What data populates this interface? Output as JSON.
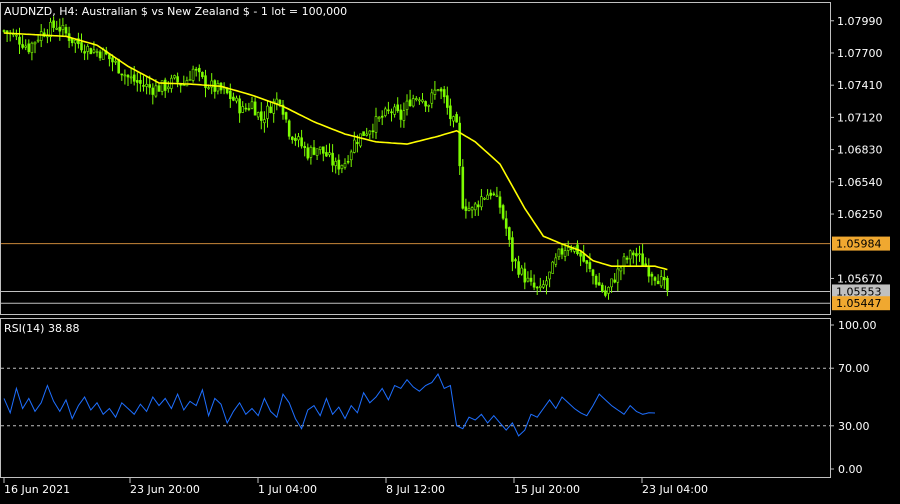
{
  "header": {
    "symbol_line": "AUDNZD, H4:  Australian $ vs New Zealand $ - 1 lot = 100,000"
  },
  "colors": {
    "background": "#000000",
    "frame": "#c0c0c0",
    "text": "#ffffff",
    "candle": "#7cfc00",
    "moving_average": "#ffff00",
    "rsi_line": "#1e6fff",
    "hline_upper": "#c8873a",
    "hline_lower": "#c0c0c0",
    "tag_upper": "#f0a830",
    "tag_current": "#c0c0c0",
    "tag_lower": "#f0a830"
  },
  "chart_data": [
    {
      "type": "candlestick",
      "symbol": "AUDNZD",
      "timeframe": "H4",
      "title": "AUDNZD, H4:  Australian $ vs New Zealand $ - 1 lot = 100,000",
      "y_range": [
        1.0535,
        1.0815
      ],
      "y_ticks": [
        "1.07990",
        "1.07700",
        "1.07410",
        "1.07120",
        "1.06830",
        "1.06540",
        "1.06250",
        "1.05670"
      ],
      "x_labels": [
        "16 Jun 2021",
        "23 Jun 20:00",
        "1 Jul 04:00",
        "8 Jul 12:00",
        "15 Jul 20:00",
        "23 Jul 04:00"
      ],
      "close_waypoints": [
        [
          0,
          1.079
        ],
        [
          4,
          1.0784
        ],
        [
          8,
          1.0775
        ],
        [
          12,
          1.0788
        ],
        [
          17,
          1.0795
        ],
        [
          22,
          1.0782
        ],
        [
          27,
          1.0774
        ],
        [
          32,
          1.077
        ],
        [
          36,
          1.076
        ],
        [
          40,
          1.0748
        ],
        [
          44,
          1.0742
        ],
        [
          48,
          1.0738
        ],
        [
          52,
          1.074
        ],
        [
          55,
          1.0745
        ],
        [
          58,
          1.0742
        ],
        [
          61,
          1.0755
        ],
        [
          64,
          1.0745
        ],
        [
          68,
          1.0738
        ],
        [
          71,
          1.0735
        ],
        [
          74,
          1.0728
        ],
        [
          77,
          1.0718
        ],
        [
          80,
          1.0725
        ],
        [
          83,
          1.071
        ],
        [
          86,
          1.0722
        ],
        [
          89,
          1.073
        ],
        [
          92,
          1.07
        ],
        [
          95,
          1.069
        ],
        [
          98,
          1.068
        ],
        [
          101,
          1.0685
        ],
        [
          104,
          1.0678
        ],
        [
          107,
          1.0668
        ],
        [
          110,
          1.0672
        ],
        [
          113,
          1.069
        ],
        [
          116,
          1.0698
        ],
        [
          119,
          1.0705
        ],
        [
          122,
          1.0712
        ],
        [
          125,
          1.0718
        ],
        [
          128,
          1.0712
        ],
        [
          131,
          1.0728
        ],
        [
          134,
          1.0732
        ],
        [
          137,
          1.0725
        ],
        [
          140,
          1.074
        ],
        [
          142,
          1.0728
        ],
        [
          144,
          1.0712
        ],
        [
          146,
          1.0702
        ],
        [
          147,
          1.0665
        ],
        [
          148,
          1.0635
        ],
        [
          151,
          1.0628
        ],
        [
          154,
          1.064
        ],
        [
          157,
          1.0645
        ],
        [
          160,
          1.0632
        ],
        [
          162,
          1.0612
        ],
        [
          164,
          1.0585
        ],
        [
          167,
          1.0572
        ],
        [
          170,
          1.056
        ],
        [
          173,
          1.0555
        ],
        [
          176,
          1.057
        ],
        [
          179,
          1.0588
        ],
        [
          182,
          1.0598
        ],
        [
          185,
          1.0592
        ],
        [
          188,
          1.0578
        ],
        [
          191,
          1.0565
        ],
        [
          194,
          1.0552
        ],
        [
          197,
          1.0568
        ],
        [
          200,
          1.0582
        ],
        [
          203,
          1.059
        ],
        [
          205,
          1.0585
        ],
        [
          208,
          1.0575
        ],
        [
          211,
          1.0568
        ],
        [
          214,
          1.0556
        ]
      ],
      "moving_average_waypoints": [
        [
          0,
          1.0788
        ],
        [
          20,
          1.0785
        ],
        [
          30,
          1.0777
        ],
        [
          40,
          1.0758
        ],
        [
          50,
          1.0743
        ],
        [
          60,
          1.0742
        ],
        [
          70,
          1.074
        ],
        [
          80,
          1.0732
        ],
        [
          90,
          1.0722
        ],
        [
          100,
          1.0708
        ],
        [
          110,
          1.0697
        ],
        [
          120,
          1.069
        ],
        [
          130,
          1.0688
        ],
        [
          140,
          1.0695
        ],
        [
          146,
          1.07
        ],
        [
          152,
          1.069
        ],
        [
          160,
          1.067
        ],
        [
          168,
          1.063
        ],
        [
          174,
          1.0605
        ],
        [
          180,
          1.0598
        ],
        [
          186,
          1.0592
        ],
        [
          190,
          1.0583
        ],
        [
          196,
          1.0578
        ],
        [
          204,
          1.0578
        ],
        [
          210,
          1.0578
        ],
        [
          214,
          1.0575
        ]
      ],
      "horizontal_lines": [
        {
          "price": 1.05984,
          "label": "1.05984",
          "style": "upper"
        },
        {
          "price": 1.05553,
          "label": "1.05553",
          "style": "current"
        },
        {
          "price": 1.05447,
          "label": "1.05447",
          "style": "lower"
        }
      ]
    },
    {
      "type": "line",
      "title": "RSI(14) 38.88",
      "indicator": "RSI(14)",
      "value": 38.88,
      "y_range": [
        0,
        100
      ],
      "y_ticks": [
        "100.00",
        "70.00",
        "30.00",
        "0.00"
      ],
      "levels": [
        70,
        30
      ],
      "waypoints": [
        [
          0,
          49
        ],
        [
          2,
          39
        ],
        [
          4,
          56
        ],
        [
          6,
          42
        ],
        [
          8,
          49
        ],
        [
          10,
          40
        ],
        [
          12,
          46
        ],
        [
          14,
          58
        ],
        [
          16,
          47
        ],
        [
          18,
          40
        ],
        [
          20,
          48
        ],
        [
          22,
          35
        ],
        [
          24,
          44
        ],
        [
          26,
          50
        ],
        [
          28,
          41
        ],
        [
          30,
          46
        ],
        [
          32,
          38
        ],
        [
          34,
          42
        ],
        [
          36,
          36
        ],
        [
          38,
          46
        ],
        [
          40,
          42
        ],
        [
          42,
          38
        ],
        [
          44,
          45
        ],
        [
          46,
          40
        ],
        [
          48,
          50
        ],
        [
          50,
          44
        ],
        [
          52,
          49
        ],
        [
          54,
          42
        ],
        [
          56,
          52
        ],
        [
          58,
          41
        ],
        [
          60,
          47
        ],
        [
          62,
          44
        ],
        [
          64,
          55
        ],
        [
          66,
          37
        ],
        [
          68,
          49
        ],
        [
          70,
          45
        ],
        [
          72,
          32
        ],
        [
          74,
          40
        ],
        [
          76,
          46
        ],
        [
          78,
          38
        ],
        [
          80,
          42
        ],
        [
          82,
          37
        ],
        [
          84,
          49
        ],
        [
          86,
          40
        ],
        [
          88,
          36
        ],
        [
          90,
          52
        ],
        [
          92,
          46
        ],
        [
          94,
          35
        ],
        [
          96,
          28
        ],
        [
          98,
          41
        ],
        [
          100,
          44
        ],
        [
          102,
          37
        ],
        [
          104,
          49
        ],
        [
          106,
          38
        ],
        [
          108,
          43
        ],
        [
          110,
          35
        ],
        [
          112,
          44
        ],
        [
          114,
          39
        ],
        [
          116,
          53
        ],
        [
          118,
          46
        ],
        [
          120,
          50
        ],
        [
          122,
          56
        ],
        [
          124,
          48
        ],
        [
          126,
          58
        ],
        [
          128,
          56
        ],
        [
          130,
          62
        ],
        [
          132,
          57
        ],
        [
          134,
          54
        ],
        [
          136,
          58
        ],
        [
          138,
          60
        ],
        [
          140,
          66
        ],
        [
          142,
          56
        ],
        [
          144,
          58
        ],
        [
          146,
          30
        ],
        [
          148,
          28
        ],
        [
          150,
          36
        ],
        [
          152,
          34
        ],
        [
          154,
          38
        ],
        [
          156,
          32
        ],
        [
          158,
          37
        ],
        [
          160,
          32
        ],
        [
          162,
          27
        ],
        [
          164,
          32
        ],
        [
          166,
          23
        ],
        [
          168,
          27
        ],
        [
          170,
          38
        ],
        [
          172,
          36
        ],
        [
          174,
          42
        ],
        [
          176,
          48
        ],
        [
          178,
          42
        ],
        [
          180,
          50
        ],
        [
          182,
          46
        ],
        [
          184,
          42
        ],
        [
          186,
          39
        ],
        [
          188,
          37
        ],
        [
          190,
          44
        ],
        [
          192,
          52
        ],
        [
          194,
          48
        ],
        [
          196,
          44
        ],
        [
          198,
          41
        ],
        [
          200,
          38
        ],
        [
          202,
          44
        ],
        [
          204,
          40
        ],
        [
          206,
          38
        ],
        [
          208,
          39
        ],
        [
          210,
          38.88
        ]
      ]
    }
  ]
}
